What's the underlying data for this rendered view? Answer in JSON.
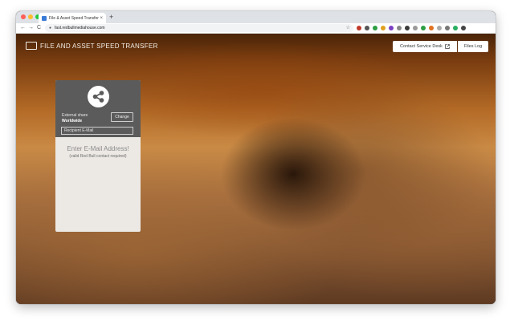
{
  "browser": {
    "tab_title": "File & Asset Speed Transfer",
    "new_tab": "+",
    "tab_close": "×",
    "url": "fast.redbullmediahouse.com",
    "nav": {
      "back": "←",
      "forward": "→",
      "reload": "C"
    },
    "traffic_lights": [
      "#ff5f57",
      "#febc2e",
      "#28c840"
    ],
    "extensions": [
      "#c0392b",
      "#555555",
      "#2e9e44",
      "#e0a020",
      "#7b3fc4",
      "#888888",
      "#3a3a3a",
      "#999999",
      "#2e9e44",
      "#e07020",
      "#aaaaaa",
      "#777777",
      "#27ae60",
      "#444444"
    ]
  },
  "header": {
    "brand": "FILE AND ASSET SPEED TRANSFER",
    "contact_button": "Contact Service Desk",
    "files_button": "Files Log"
  },
  "share_panel": {
    "label": "External share",
    "value": "Worldwide",
    "change_button": "Change",
    "recipient_placeholder": "Recipient E-Mail",
    "prompt": "Enter E-Mail Address!",
    "note": "(valid Red Bull contact required)"
  }
}
